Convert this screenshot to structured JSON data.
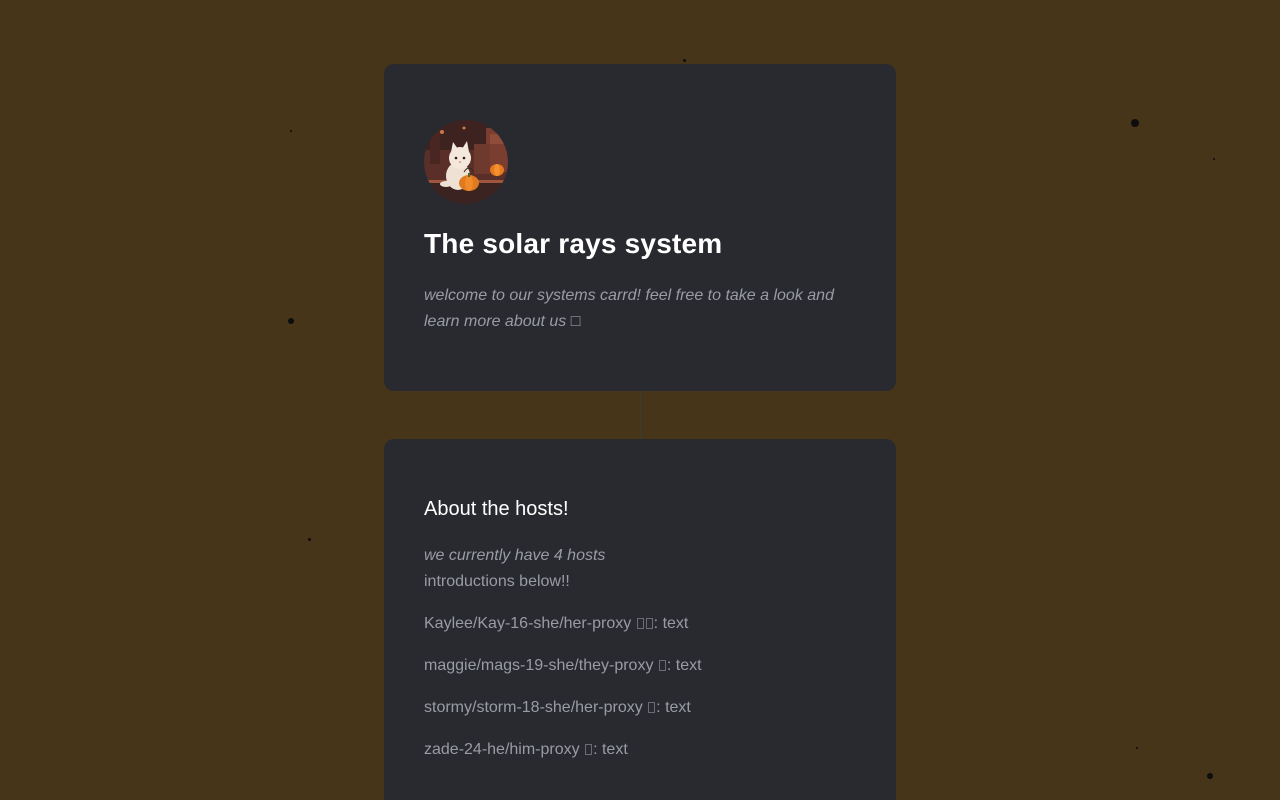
{
  "site": {
    "title": "The solar rays system",
    "subtitle": "welcome to our systems carrd! feel free to take a look and learn more about us □"
  },
  "hosts_section": {
    "heading": "About the hosts!",
    "intro_italic": "we currently have 4 hosts",
    "intro_line": "introductions below!!",
    "hosts": [
      {
        "label": "Kaylee/Kay-16-she/her-proxy",
        "proxy_suffix": ": text"
      },
      {
        "label": "maggie/mags-19-she/they-proxy",
        "proxy_suffix": ": text"
      },
      {
        "label": "stormy/storm-18-she/her-proxy",
        "proxy_suffix": ": text"
      },
      {
        "label": "zade-24-he/him-proxy",
        "proxy_suffix": ": text"
      }
    ]
  },
  "colors": {
    "background": "#463518",
    "card": "#282a30",
    "title": "#ffffff",
    "body_text": "#9a9ca3"
  },
  "icons": {
    "avatar": "cat-with-pumpkin-avatar"
  }
}
